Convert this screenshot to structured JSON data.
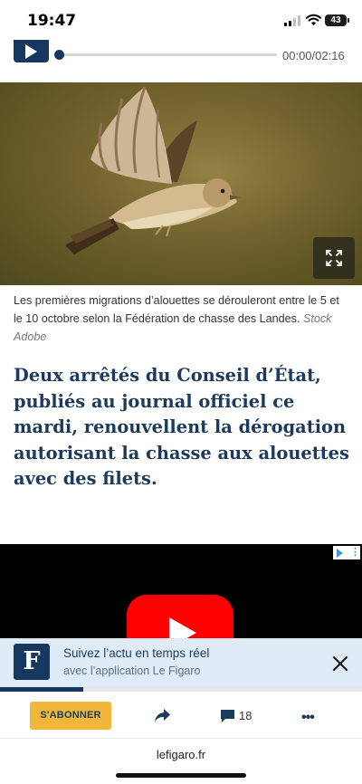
{
  "status_bar": {
    "time": "19:47",
    "battery_level": "43"
  },
  "audio_player": {
    "time_readout": "00:00/02:16",
    "progress_percent": 0
  },
  "hero_image": {
    "subject": "lark in flight"
  },
  "caption": {
    "text": "Les premières migrations d’alouettes se dérouleront entre le 5 et le 10 octobre selon la Fédération de chasse des Landes.",
    "credit": "Stock Adobe"
  },
  "article": {
    "lead": "Deux arrêtés du Conseil d’État, publiés au journal officiel ce mardi, renouvellent la dérogation autorisant la chasse aux alouettes avec des filets."
  },
  "ad": {
    "badge_dots": "⋮"
  },
  "app_banner": {
    "icon_letter": "F",
    "title": "Suivez l’actu en temps réel",
    "subtitle": "avec l’application Le Figaro",
    "progress_percent": 23
  },
  "toolbar": {
    "subscribe_label": "S'ABONNER",
    "comment_count": "18",
    "more_label": "•••"
  },
  "url_bar": {
    "url": "lefigaro.fr"
  },
  "colors": {
    "brand_navy": "#163860",
    "subscribe_yellow": "#f1b73a",
    "youtube_red": "#ff0000",
    "banner_bg": "#dfecf8"
  },
  "icons": [
    "signal-icon",
    "wifi-icon",
    "battery-icon",
    "play-icon",
    "expand-icon",
    "ad-choices-icon",
    "youtube-play-icon",
    "figaro-app-icon",
    "close-icon",
    "share-icon",
    "comment-icon",
    "more-icon"
  ]
}
